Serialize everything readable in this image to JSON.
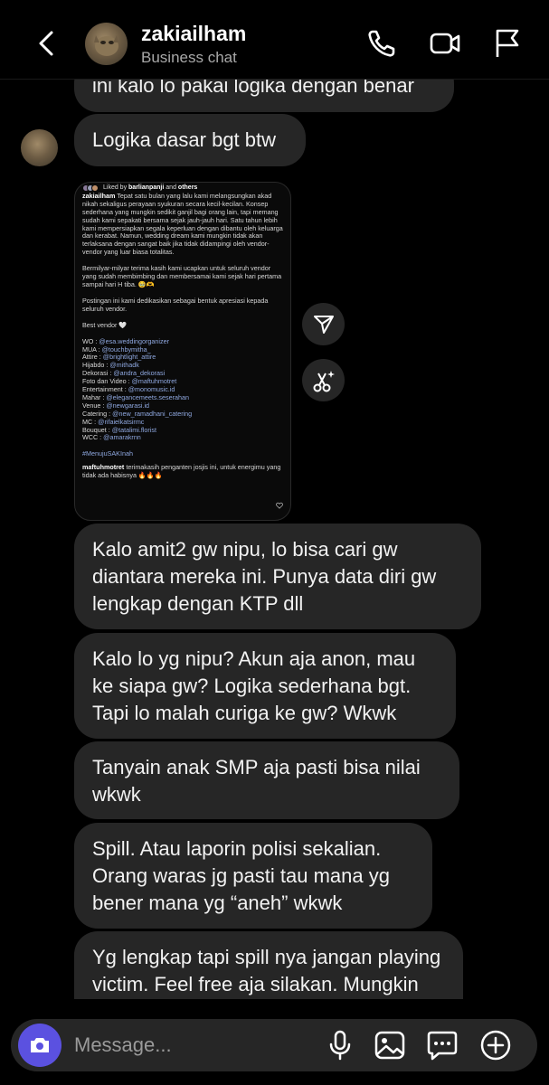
{
  "header": {
    "back_icon": "chevron-left-icon",
    "name": "zakiailham",
    "subtitle": "Business chat",
    "icons": [
      "phone-icon",
      "video-camera-icon",
      "flag-icon"
    ]
  },
  "messages": [
    {
      "text": "ini kalo lo pakai logika dengan benar"
    },
    {
      "text": "Logika dasar bgt btw"
    },
    {
      "text": "Kalo amit2 gw nipu, lo bisa cari gw diantara mereka ini. Punya data diri gw lengkap dengan KTP dll"
    },
    {
      "text": "Kalo lo yg nipu? Akun aja anon, mau ke siapa gw? Logika sederhana bgt. Tapi lo malah curiga ke gw? Wkwk"
    },
    {
      "text": "Tanyain anak SMP aja pasti bisa nilai wkwk"
    },
    {
      "text": "Spill. Atau laporin polisi sekalian. Orang waras jg pasti tau mana yg bener mana yg “aneh” wkwk"
    },
    {
      "text": "Yg lengkap tapi spill nya jangan playing victim. Feel free aja silakan. Mungkin itu bikin lo ngerasa bahagia."
    }
  ],
  "shared_post": {
    "liked_prefix": "Liked by",
    "liked_user": "barlianpanji",
    "liked_and": "and",
    "liked_others": "others",
    "author": "zakiailham",
    "caption": "Tepat satu bulan yang lalu kami melangsungkan akad nikah sekaligus perayaan syukuran secara kecil-kecilan. Konsep sederhana yang mungkin sedikit ganjil bagi orang lain, tapi memang sudah kami sepakati bersama sejak jauh-jauh hari. Satu tahun lebih kami mempersiapkan segala keperluan dengan dibantu oleh keluarga dan kerabat. Namun, wedding dream kami mungkin tidak akan terlaksana dengan sangat baik jika tidak didampingi oleh vendor-vendor yang luar biasa totalitas.",
    "para2": "Bermilyar-milyar terima kasih kami ucapkan untuk seluruh vendor yang sudah membimbing dan membersamai kami sejak hari pertama sampai hari H tiba. 🥹🫶",
    "para3": "Postingan ini kami dedikasikan sebagai bentuk apresiasi kepada seluruh vendor.",
    "best_vendor": "Best vendor 🤍",
    "vendors": [
      {
        "label": "WO : ",
        "handle": "@esa.weddingorganizer"
      },
      {
        "label": "MUA : ",
        "handle": "@touchbymitha_"
      },
      {
        "label": "Attire : ",
        "handle": "@brightlight_attire"
      },
      {
        "label": "Hijabdo : ",
        "handle": "@mithadk"
      },
      {
        "label": "Dekorasi : ",
        "handle": "@andra_dekorasi"
      },
      {
        "label": "Foto dan Video : ",
        "handle": "@maftuhmotret"
      },
      {
        "label": "Entertainment : ",
        "handle": "@monomusic.id"
      },
      {
        "label": "Mahar : ",
        "handle": "@elegancemeets.seserahan"
      },
      {
        "label": "Venue : ",
        "handle": "@newgarasi.id"
      },
      {
        "label": "Catering : ",
        "handle": "@new_ramadhani_catering"
      },
      {
        "label": "MC : ",
        "handle": "@rifaielkatsirmc"
      },
      {
        "label": "Bouquet : ",
        "handle": "@tatalimi.florist"
      },
      {
        "label": "WCC : ",
        "handle": "@amarakrnn"
      }
    ],
    "hashtag": "#MenujuSAKInah",
    "comment_user": "maftuhmotret",
    "comment_text": "terimakasih penganten josjis ini, untuk energimu yang tidak ada habisnya 🔥🔥🔥"
  },
  "side_actions": [
    "send-icon",
    "sparkle-scissors-icon"
  ],
  "composer": {
    "placeholder": "Message...",
    "icons": [
      "camera-icon",
      "microphone-icon",
      "gallery-icon",
      "sticker-chat-icon",
      "plus-icon"
    ],
    "camera_color": "#5b51e0"
  }
}
